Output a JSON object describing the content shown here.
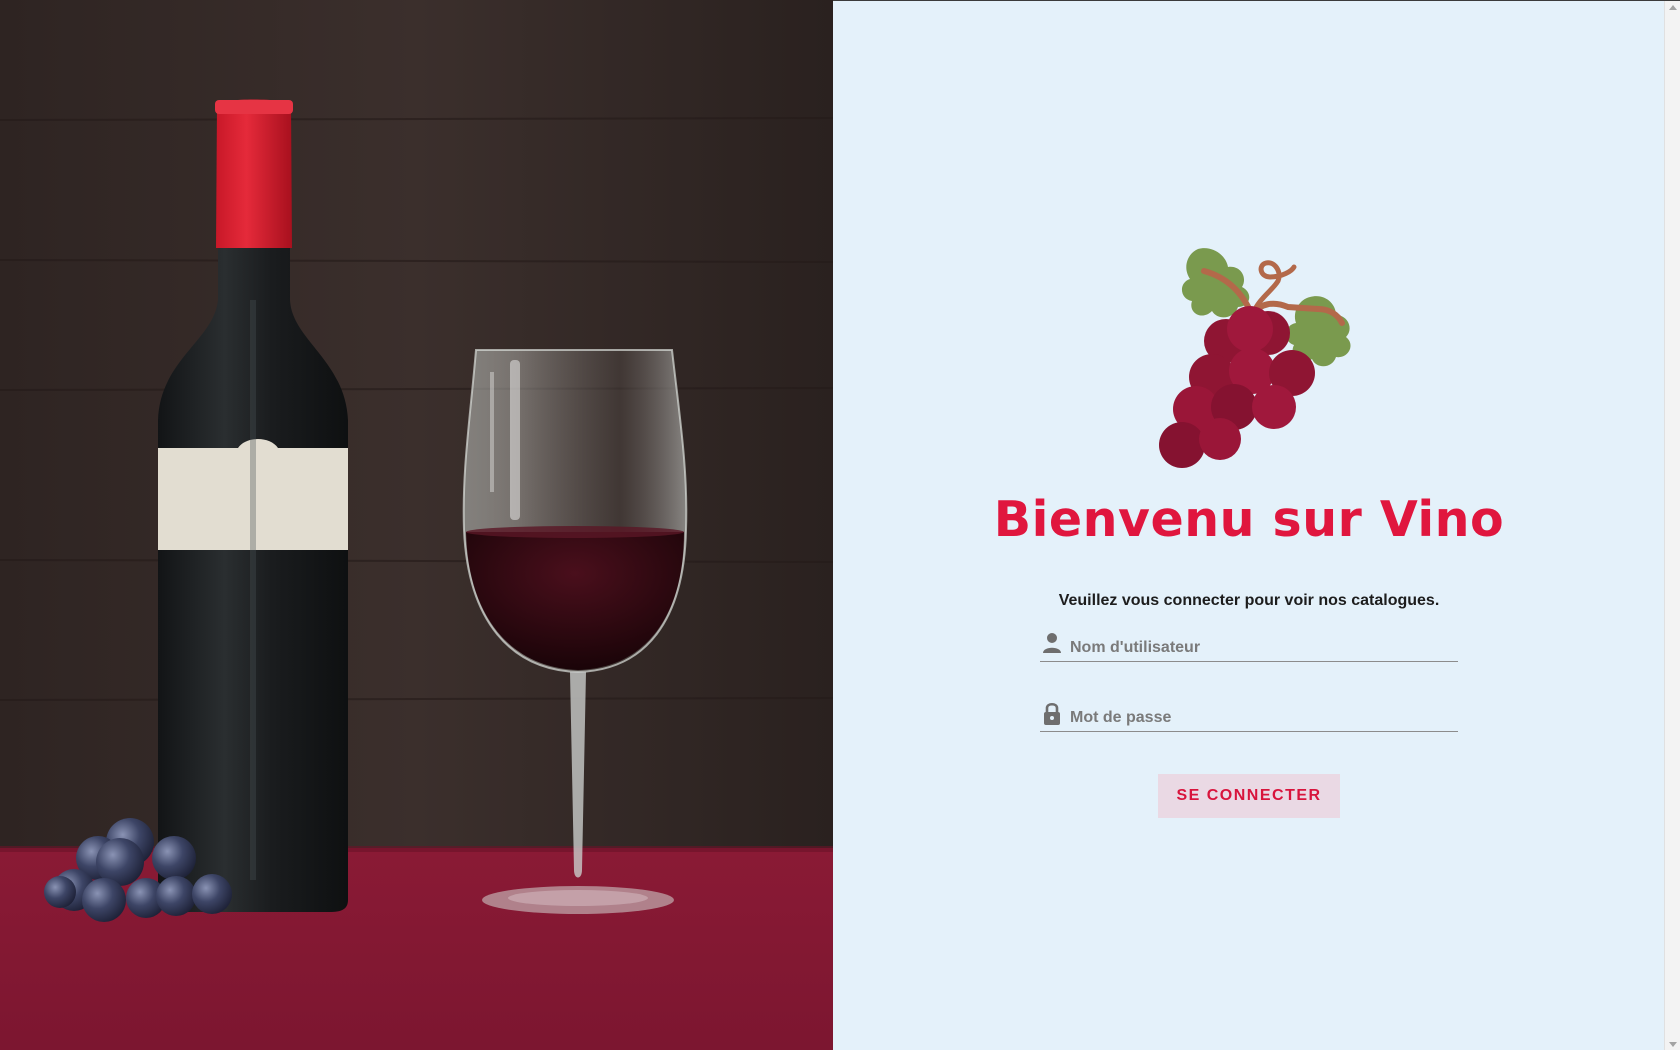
{
  "login": {
    "title": "Bienvenu sur Vino",
    "subtitle": "Veuillez vous connecter pour voir nos catalogues.",
    "username_placeholder": "Nom d'utilisateur",
    "password_placeholder": "Mot de passe",
    "submit_label": "SE CONNECTER"
  },
  "hero": {
    "subject": "wine-bottle-glass-grapes-photo"
  },
  "colors": {
    "panel_background": "#e4f1fa",
    "accent": "#e0163e",
    "button_background": "#ead9e4",
    "grape": "#9a1238",
    "leaf": "#7a9a4e",
    "stem": "#b3694a"
  },
  "icons": {
    "logo": "grapes-icon",
    "username": "person-icon",
    "password": "lock-icon"
  }
}
